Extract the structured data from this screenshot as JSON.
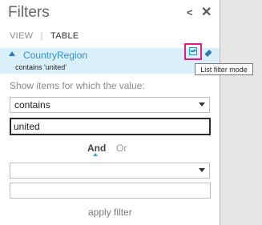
{
  "panel": {
    "title": "Filters",
    "collapse_icon": "chevron-left-icon",
    "close_icon": "close-icon"
  },
  "tabs": {
    "view": "VIEW",
    "separator": "|",
    "table": "TABLE"
  },
  "filter": {
    "field_name": "CountryRegion",
    "description": "contains 'united'",
    "mode_icon": "filter-mode-icon",
    "eraser_icon": "eraser-icon",
    "tooltip": "List filter mode"
  },
  "advanced": {
    "show_label": "Show items for which the value:",
    "condition1": "contains",
    "value1": "united",
    "and_label": "And",
    "or_label": "Or",
    "condition2": "",
    "value2": "",
    "apply_label": "apply filter"
  },
  "colors": {
    "accent": "#2f8ecf",
    "highlight_row": "#d9f0fb",
    "callout": "#e21b8b"
  }
}
